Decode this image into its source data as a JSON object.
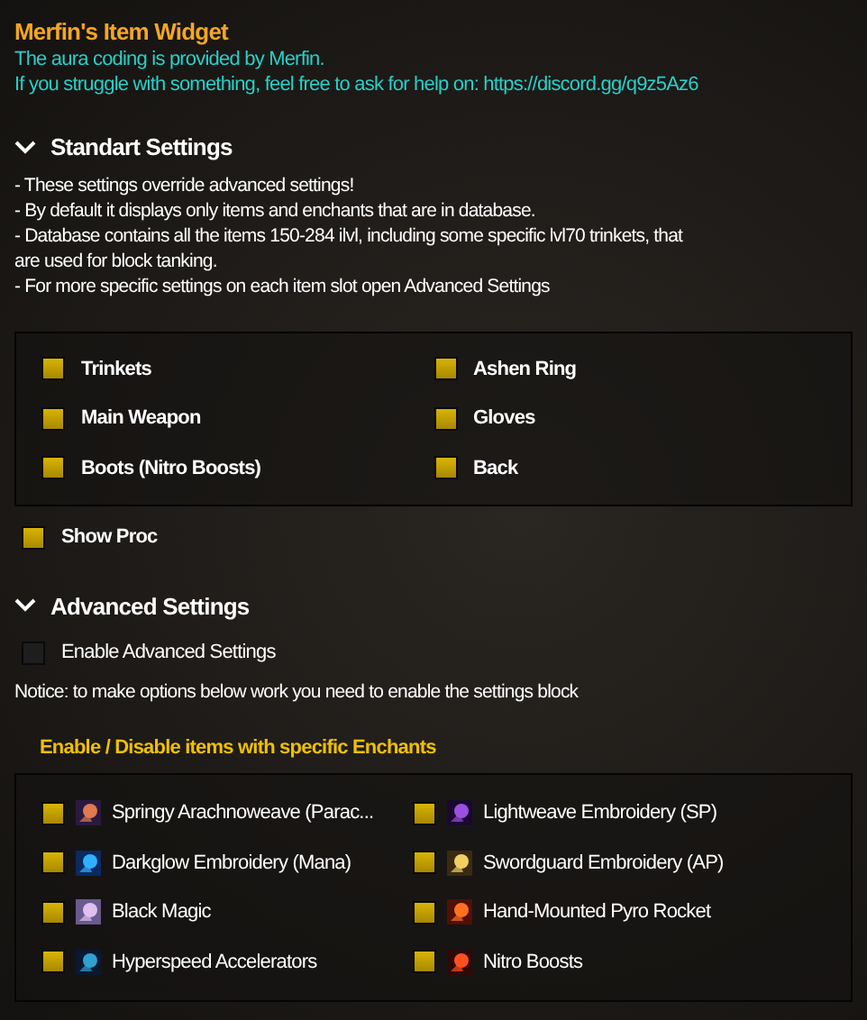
{
  "title": "Merfin's Item Widget",
  "credits": [
    "The aura coding is provided by Merfin.",
    "If you struggle with something, feel free to ask for help on: https://discord.gg/q9z5Az6"
  ],
  "standard": {
    "header": "Standart Settings",
    "expanded": true,
    "notes": [
      "- These settings override advanced settings!",
      "- By default it displays only items and enchants that are in database.",
      "- Database contains all the items 150-284 ilvl, including some specific lvl70 trinkets, that are used for block tanking.",
      "- For more specific settings on each item slot open Advanced Settings"
    ],
    "options": [
      {
        "label": "Trinkets",
        "checked": true
      },
      {
        "label": "Ashen Ring",
        "checked": true
      },
      {
        "label": "Main Weapon",
        "checked": true
      },
      {
        "label": "Gloves",
        "checked": true
      },
      {
        "label": "Boots (Nitro Boosts)",
        "checked": true
      },
      {
        "label": "Back",
        "checked": true
      }
    ],
    "show_proc": {
      "label": "Show Proc",
      "checked": true
    }
  },
  "advanced": {
    "header": "Advanced Settings",
    "expanded": true,
    "enable": {
      "label": "Enable Advanced Settings",
      "checked": false
    },
    "notice": "Notice: to make options below work you need to enable the settings block",
    "enchants_title": "Enable / Disable items with specific Enchants",
    "enchants": [
      {
        "label": "Springy Arachnoweave (Parac...",
        "checked": true
      },
      {
        "label": "Lightweave Embroidery (SP)",
        "checked": true
      },
      {
        "label": "Darkglow Embroidery (Mana)",
        "checked": true
      },
      {
        "label": "Swordguard Embroidery (AP)",
        "checked": true
      },
      {
        "label": "Black Magic",
        "checked": true
      },
      {
        "label": "Hand-Mounted Pyro Rocket",
        "checked": true
      },
      {
        "label": "Hyperspeed Accelerators",
        "checked": true
      },
      {
        "label": "Nitro Boosts",
        "checked": true
      }
    ]
  }
}
